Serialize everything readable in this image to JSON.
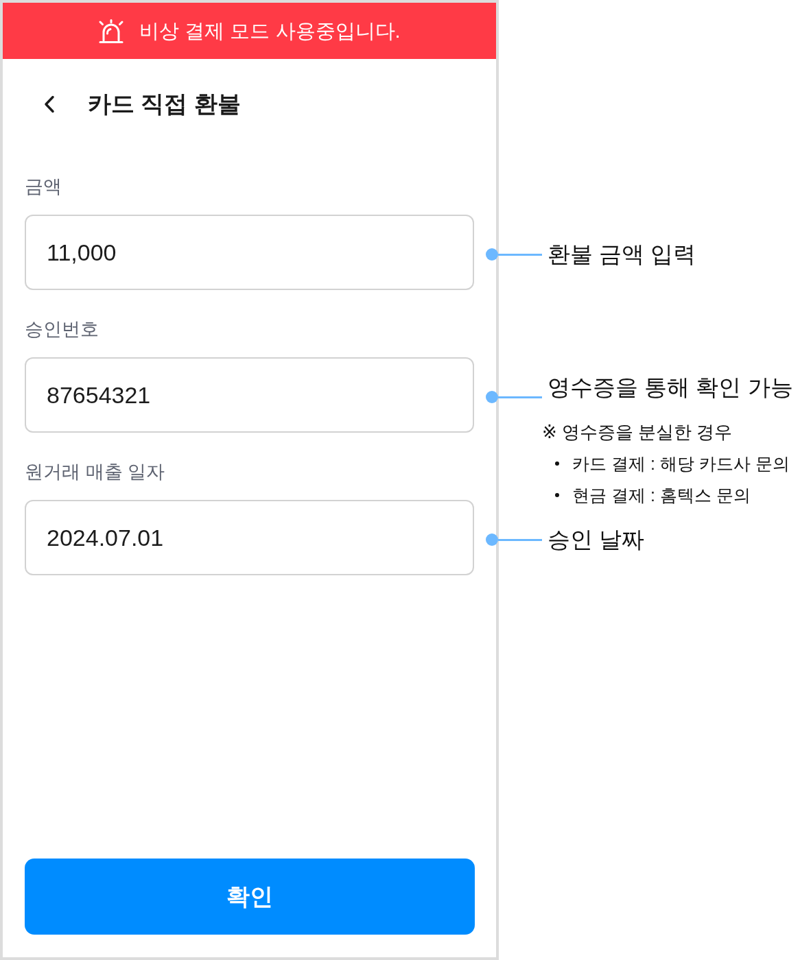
{
  "banner": {
    "text": "비상 결제 모드 사용중입니다."
  },
  "header": {
    "title": "카드 직접 환불"
  },
  "fields": [
    {
      "label": "금액",
      "value": "11,000",
      "annotation": {
        "text": "환불 금액 입력"
      }
    },
    {
      "label": "승인번호",
      "value": "87654321",
      "annotation": {
        "text": "영수증을 통해 확인 가능",
        "note": {
          "heading": "※ 영수증을 분실한 경우",
          "items": [
            "카드 결제 : 해당 카드사 문의",
            "현금 결제 : 홈텍스 문의"
          ]
        }
      }
    },
    {
      "label": "원거래 매출 일자",
      "value": "2024.07.01",
      "annotation": {
        "text": "승인 날짜"
      }
    }
  ],
  "confirm_button": {
    "label": "확인"
  }
}
